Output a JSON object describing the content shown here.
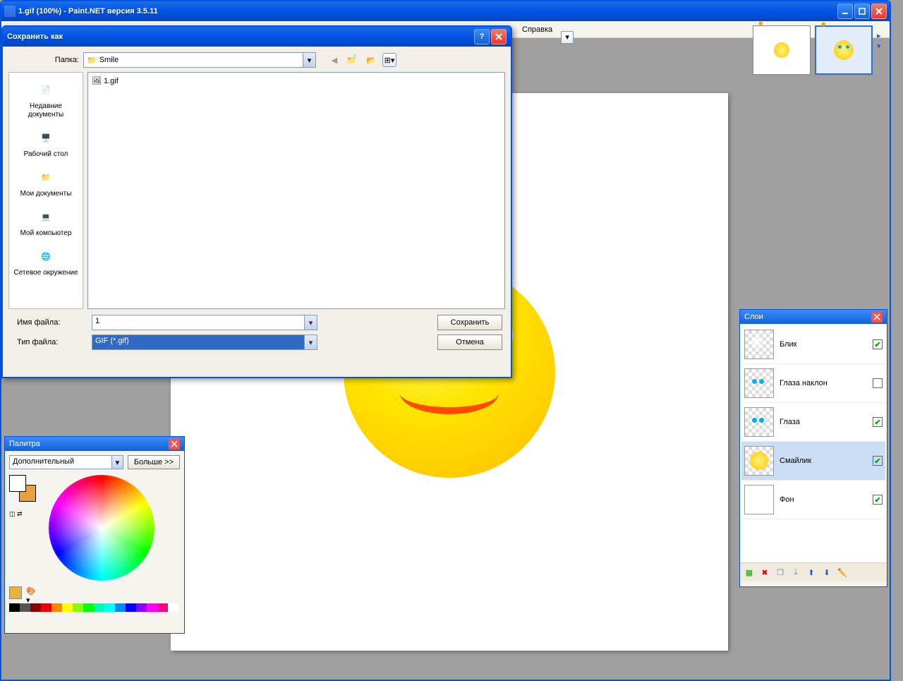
{
  "window": {
    "title": "1.gif (100%) - Paint.NET версия 3.5.11"
  },
  "menu": {
    "help": "Справка"
  },
  "saveDialog": {
    "title": "Сохранить как",
    "folderLabel": "Папка:",
    "folderValue": "Smile",
    "files": [
      "1.gif"
    ],
    "filenameLabel": "Имя файла:",
    "filenameValue": "1",
    "filetypeLabel": "Тип файла:",
    "filetypeValue": "GIF (*.gif)",
    "saveBtn": "Сохранить",
    "cancelBtn": "Отмена",
    "places": [
      "Недавние документы",
      "Рабочий стол",
      "Мои документы",
      "Мой компьютер",
      "Сетевое окружение"
    ]
  },
  "palette": {
    "title": "Палитра",
    "mode": "Дополнительный",
    "moreBtn": "Больше >>",
    "stripColors": [
      "#000",
      "#555",
      "#800",
      "#e00",
      "#f80",
      "#ff0",
      "#8f0",
      "#0f0",
      "#0fa",
      "#0ff",
      "#08f",
      "#00f",
      "#80f",
      "#f0f",
      "#f08",
      "#fff"
    ]
  },
  "layers": {
    "title": "Слои",
    "items": [
      {
        "name": "Блик",
        "checked": true
      },
      {
        "name": "Глаза наклон",
        "checked": false
      },
      {
        "name": "Глаза",
        "checked": true
      },
      {
        "name": "Смайлик",
        "checked": true,
        "selected": true
      },
      {
        "name": "Фон",
        "checked": true
      }
    ]
  }
}
